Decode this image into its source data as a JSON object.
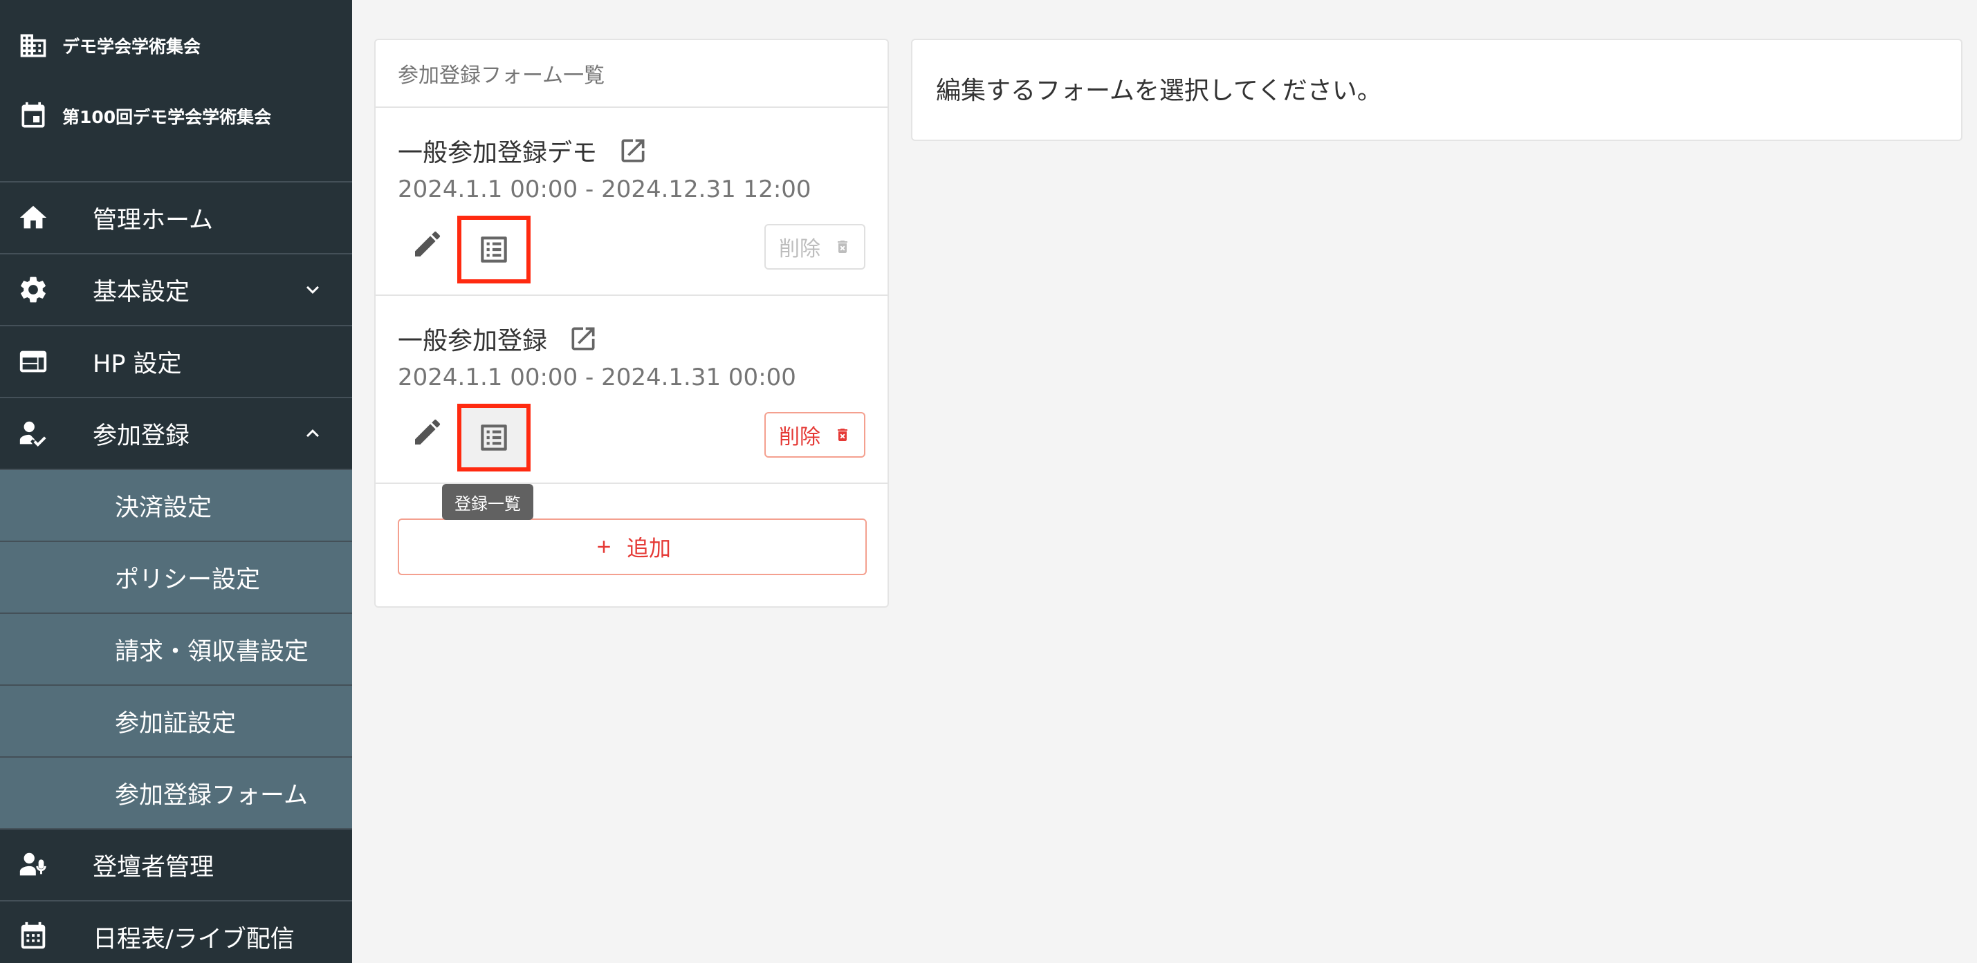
{
  "sidebar": {
    "org_name": "デモ学会学術集会",
    "event_name": "第100回デモ学会学術集会",
    "items": [
      {
        "label": "管理ホーム",
        "icon": "home-icon"
      },
      {
        "label": "基本設定",
        "icon": "gear-icon",
        "chevron": "chevron-down-icon"
      },
      {
        "label": "HP 設定",
        "icon": "web-icon"
      },
      {
        "label": "参加登録",
        "icon": "person-check-icon",
        "chevron": "chevron-up-icon"
      },
      {
        "label": "決済設定"
      },
      {
        "label": "ポリシー設定"
      },
      {
        "label": "請求・領収書設定"
      },
      {
        "label": "参加証設定"
      },
      {
        "label": "参加登録フォーム"
      },
      {
        "label": "登壇者管理",
        "icon": "speaker-icon"
      },
      {
        "label": "日程表/ライブ配信",
        "icon": "calendar-grid-icon"
      }
    ]
  },
  "form_list": {
    "header": "参加登録フォーム一覧",
    "forms": [
      {
        "title": "一般参加登録デモ",
        "period": "2024.1.1 00:00 - 2024.12.31 12:00",
        "delete_label": "削除",
        "delete_enabled": false
      },
      {
        "title": "一般参加登録",
        "period": "2024.1.1 00:00 - 2024.1.31 00:00",
        "delete_label": "削除",
        "delete_enabled": true
      }
    ],
    "tooltip": "登録一覧",
    "add_label": "追加"
  },
  "detail": {
    "message": "編集するフォームを選択してください。"
  },
  "colors": {
    "sidebar_bg": "#263238",
    "sidebar_sub_bg": "#546e7a",
    "accent_red": "#e53935",
    "highlight_red": "#ff2a10"
  }
}
